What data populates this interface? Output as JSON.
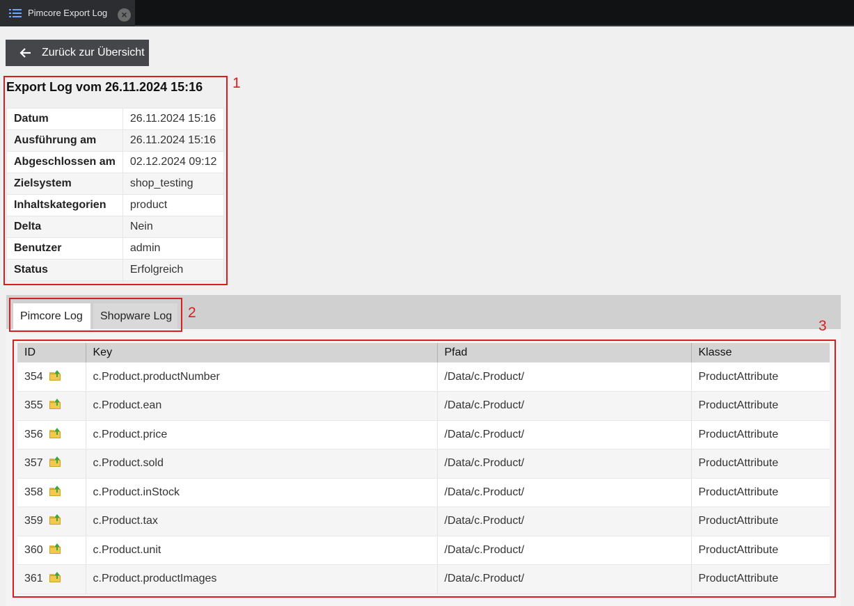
{
  "window_tab": {
    "title": "Pimcore Export Log",
    "icon": "list-icon",
    "close_icon": "close-icon"
  },
  "back_button": {
    "label": "Zurück zur Übersicht",
    "icon": "arrow-left-icon"
  },
  "log": {
    "title": "Export Log vom 26.11.2024 15:16",
    "fields": [
      {
        "key": "Datum",
        "value": "26.11.2024 15:16"
      },
      {
        "key": "Ausführung am",
        "value": "26.11.2024 15:16"
      },
      {
        "key": "Abgeschlossen am",
        "value": "02.12.2024 09:12"
      },
      {
        "key": "Zielsystem",
        "value": "shop_testing"
      },
      {
        "key": "Inhaltskategorien",
        "value": "product"
      },
      {
        "key": "Delta",
        "value": "Nein"
      },
      {
        "key": "Benutzer",
        "value": "admin"
      },
      {
        "key": "Status",
        "value": "Erfolgreich"
      }
    ]
  },
  "log_tabs": [
    {
      "label": "Pimcore Log",
      "active": true
    },
    {
      "label": "Shopware Log",
      "active": false
    }
  ],
  "grid": {
    "columns": [
      "ID",
      "Key",
      "Pfad",
      "Klasse"
    ],
    "rows": [
      {
        "id": "354",
        "key": "c.Product.productNumber",
        "path": "/Data/c.Product/",
        "class": "ProductAttribute"
      },
      {
        "id": "355",
        "key": "c.Product.ean",
        "path": "/Data/c.Product/",
        "class": "ProductAttribute"
      },
      {
        "id": "356",
        "key": "c.Product.price",
        "path": "/Data/c.Product/",
        "class": "ProductAttribute"
      },
      {
        "id": "357",
        "key": "c.Product.sold",
        "path": "/Data/c.Product/",
        "class": "ProductAttribute"
      },
      {
        "id": "358",
        "key": "c.Product.inStock",
        "path": "/Data/c.Product/",
        "class": "ProductAttribute"
      },
      {
        "id": "359",
        "key": "c.Product.tax",
        "path": "/Data/c.Product/",
        "class": "ProductAttribute"
      },
      {
        "id": "360",
        "key": "c.Product.unit",
        "path": "/Data/c.Product/",
        "class": "ProductAttribute"
      },
      {
        "id": "361",
        "key": "c.Product.productImages",
        "path": "/Data/c.Product/",
        "class": "ProductAttribute"
      }
    ],
    "row_icon": "folder-export-icon"
  },
  "annotations": [
    "1",
    "2",
    "3"
  ],
  "colors": {
    "annotation": "#d81e1e",
    "topbar": "#111214",
    "button": "#444649",
    "accent_icon": "#6fa8ff"
  }
}
